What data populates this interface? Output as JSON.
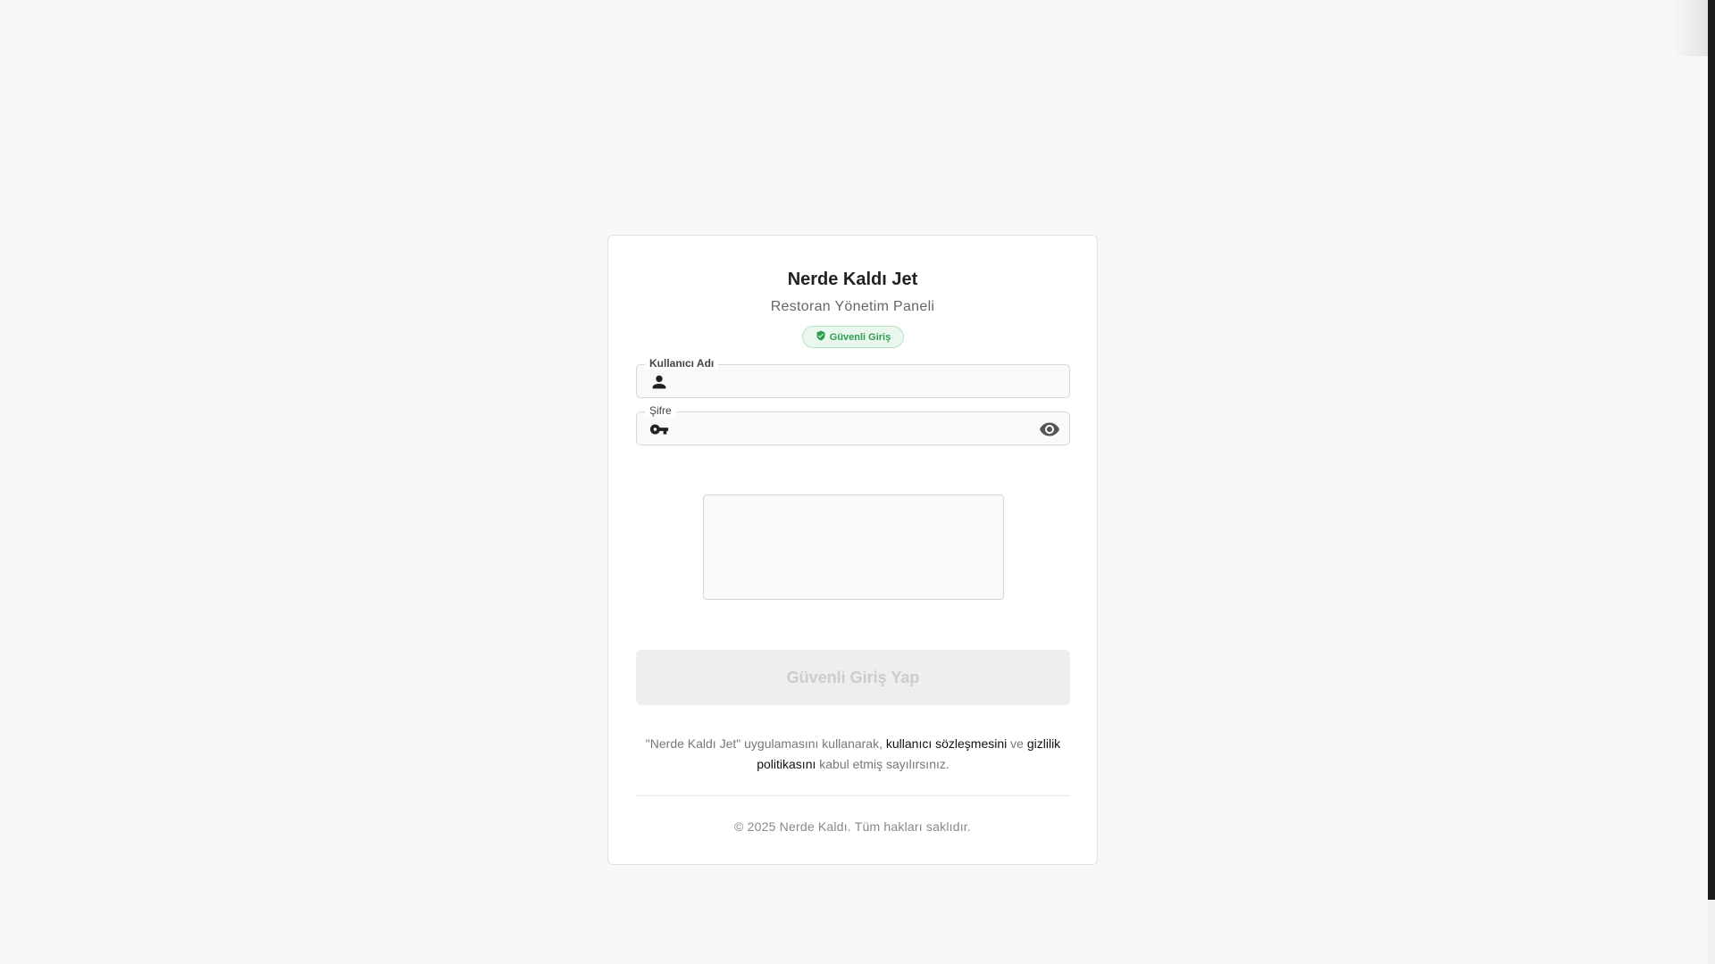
{
  "app": {
    "title": "Nerde Kaldı Jet",
    "subtitle": "Restoran Yönetim Paneli"
  },
  "badge": {
    "label": "Güvenli Giriş",
    "icon": "shield-check-icon",
    "color": "#2e9d50"
  },
  "form": {
    "username": {
      "label": "Kullanıcı Adı",
      "value": "",
      "icon": "person-icon"
    },
    "password": {
      "label": "Şifre",
      "value": "",
      "icon": "key-icon",
      "toggle_icon": "eye-icon"
    },
    "submit_label": "Güvenli Giriş Yap"
  },
  "terms": {
    "prefix": "\"Nerde Kaldı Jet\" uygulamasını kullanarak,",
    "user_agreement": "kullanıcı sözleşmesini",
    "and": "ve",
    "privacy_policy": "gizlilik politikasını",
    "suffix": "kabul etmiş sayılırsınız."
  },
  "footer": {
    "copyright": "© 2025 Nerde Kaldı. Tüm hakları saklıdır."
  }
}
